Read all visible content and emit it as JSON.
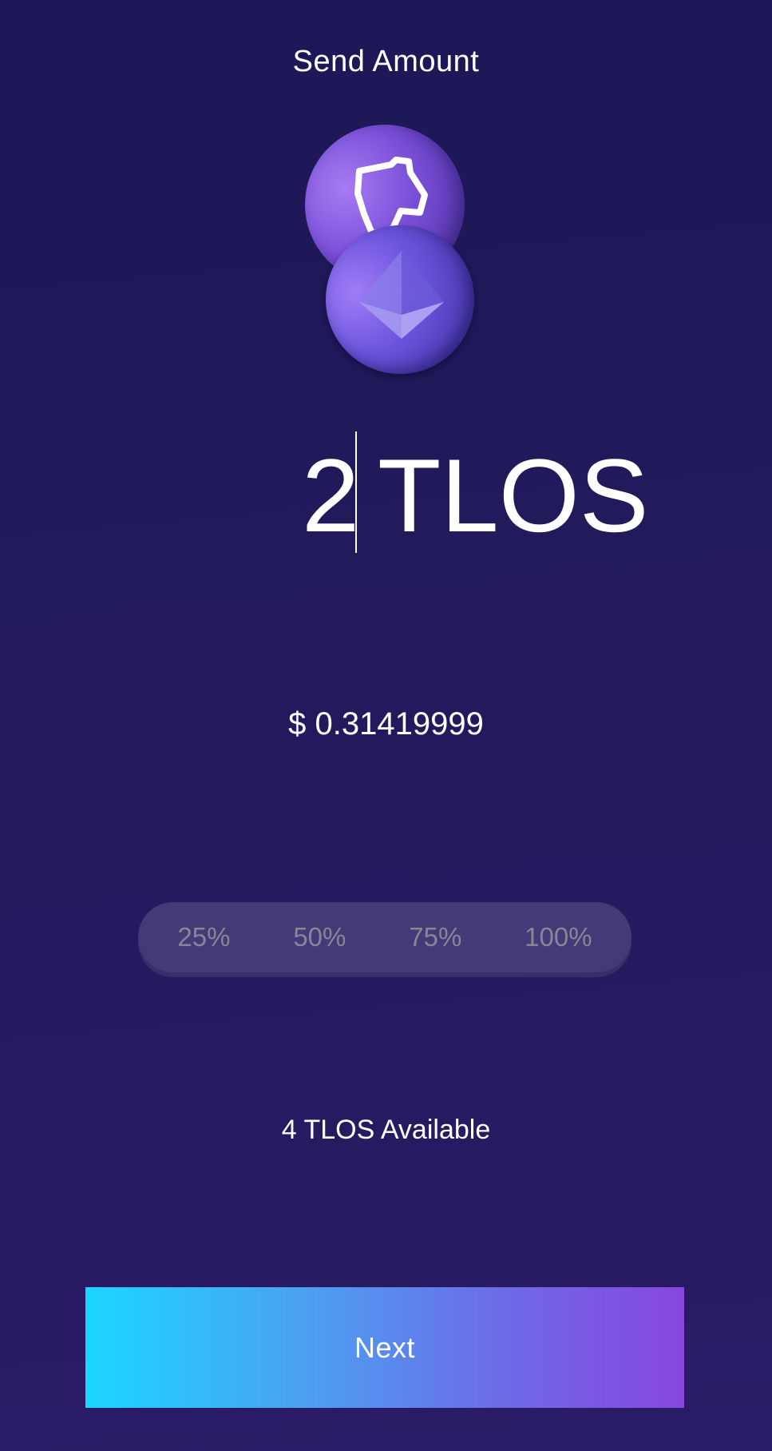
{
  "header": {
    "title": "Send Amount"
  },
  "token": {
    "primary_icon": "telos-icon",
    "secondary_icon": "ethereum-icon"
  },
  "amount": {
    "value": "2",
    "unit": "TLOS"
  },
  "fiat": {
    "value": "$ 0.31419999"
  },
  "percent_options": {
    "p25": "25%",
    "p50": "50%",
    "p75": "75%",
    "p100": "100%"
  },
  "balance": {
    "available_text": "4 TLOS Available"
  },
  "actions": {
    "next_label": "Next"
  },
  "colors": {
    "background": "#1f1859",
    "button_gradient_start": "#1bd6ff",
    "button_gradient_end": "#8846e0",
    "percent_bar": "#433a77",
    "percent_text": "#8a8595"
  }
}
